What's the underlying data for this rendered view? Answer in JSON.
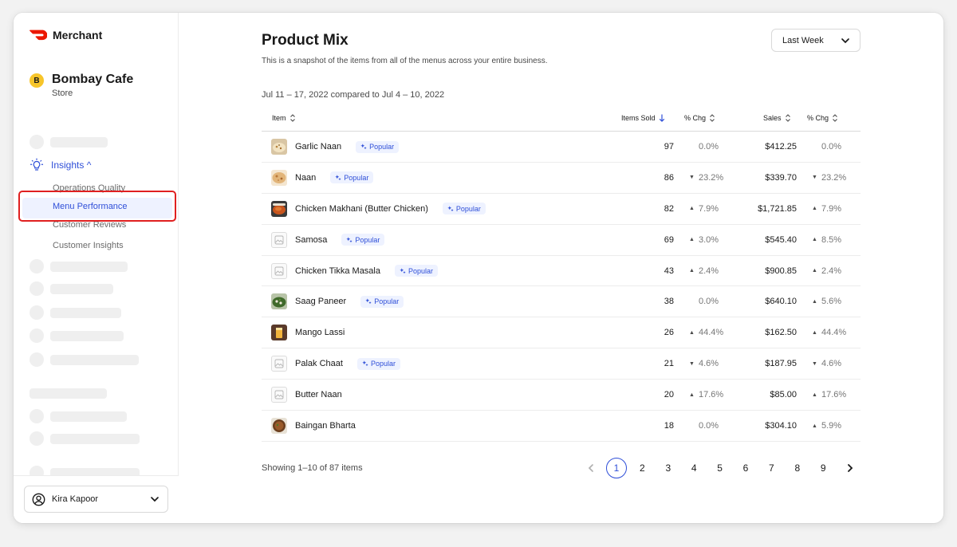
{
  "brand": {
    "name": "Merchant",
    "logo_color": "#eb1700"
  },
  "store": {
    "badge": "B",
    "name": "Bombay Cafe",
    "type": "Store"
  },
  "nav": {
    "insights_label": "Insights ^",
    "sub_items": [
      "Operations Quality",
      "Menu Performance",
      "Customer Reviews",
      "Customer Insights"
    ],
    "active_item": "Menu Performance"
  },
  "user": {
    "name": "Kira Kapoor"
  },
  "page": {
    "title": "Product Mix",
    "subtitle": "This is a snapshot of the items from all of the menus across your entire business.",
    "range_select": "Last Week",
    "date_range": "Jul 11 – 17, 2022 compared to Jul 4 – 10, 2022"
  },
  "table": {
    "headers": {
      "item": "Item",
      "items_sold": "Items Sold",
      "items_chg": "% Chg",
      "sales": "Sales",
      "sales_chg": "% Chg"
    },
    "popular_label": "Popular",
    "rows": [
      {
        "name": "Garlic Naan",
        "popular": true,
        "sold": "97",
        "sold_dir": "",
        "sold_chg": "0.0%",
        "sales": "$412.25",
        "sales_dir": "",
        "sales_chg": "0.0%",
        "thumb": "naan"
      },
      {
        "name": "Naan",
        "popular": true,
        "sold": "86",
        "sold_dir": "▼",
        "sold_chg": "23.2%",
        "sales": "$339.70",
        "sales_dir": "▼",
        "sales_chg": "23.2%",
        "thumb": "bread"
      },
      {
        "name": "Chicken Makhani (Butter Chicken)",
        "popular": true,
        "sold": "82",
        "sold_dir": "▲",
        "sold_chg": "7.9%",
        "sales": "$1,721.85",
        "sales_dir": "▲",
        "sales_chg": "7.9%",
        "thumb": "curry"
      },
      {
        "name": "Samosa",
        "popular": true,
        "sold": "69",
        "sold_dir": "▲",
        "sold_chg": "3.0%",
        "sales": "$545.40",
        "sales_dir": "▲",
        "sales_chg": "8.5%",
        "thumb": ""
      },
      {
        "name": "Chicken Tikka Masala",
        "popular": true,
        "sold": "43",
        "sold_dir": "▲",
        "sold_chg": "2.4%",
        "sales": "$900.85",
        "sales_dir": "▲",
        "sales_chg": "2.4%",
        "thumb": ""
      },
      {
        "name": "Saag Paneer",
        "popular": true,
        "sold": "38",
        "sold_dir": "",
        "sold_chg": "0.0%",
        "sales": "$640.10",
        "sales_dir": "▲",
        "sales_chg": "5.6%",
        "thumb": "greens"
      },
      {
        "name": "Mango Lassi",
        "popular": false,
        "sold": "26",
        "sold_dir": "▲",
        "sold_chg": "44.4%",
        "sales": "$162.50",
        "sales_dir": "▲",
        "sales_chg": "44.4%",
        "thumb": "lassi"
      },
      {
        "name": "Palak Chaat",
        "popular": true,
        "sold": "21",
        "sold_dir": "▼",
        "sold_chg": "4.6%",
        "sales": "$187.95",
        "sales_dir": "▼",
        "sales_chg": "4.6%",
        "thumb": ""
      },
      {
        "name": "Butter Naan",
        "popular": false,
        "sold": "20",
        "sold_dir": "▲",
        "sold_chg": "17.6%",
        "sales": "$85.00",
        "sales_dir": "▲",
        "sales_chg": "17.6%",
        "thumb": ""
      },
      {
        "name": "Baingan Bharta",
        "popular": false,
        "sold": "18",
        "sold_dir": "",
        "sold_chg": "0.0%",
        "sales": "$304.10",
        "sales_dir": "▲",
        "sales_chg": "5.9%",
        "thumb": "eggplant"
      }
    ]
  },
  "footer": {
    "showing": "Showing 1–10 of 87 items"
  },
  "pagination": {
    "pages": [
      "1",
      "2",
      "3",
      "4",
      "5",
      "6",
      "7",
      "8",
      "9"
    ],
    "current": "1"
  },
  "colors": {
    "accent": "#2f4fd8",
    "highlight": "#e02020",
    "popular_bg": "#eef2ff"
  }
}
